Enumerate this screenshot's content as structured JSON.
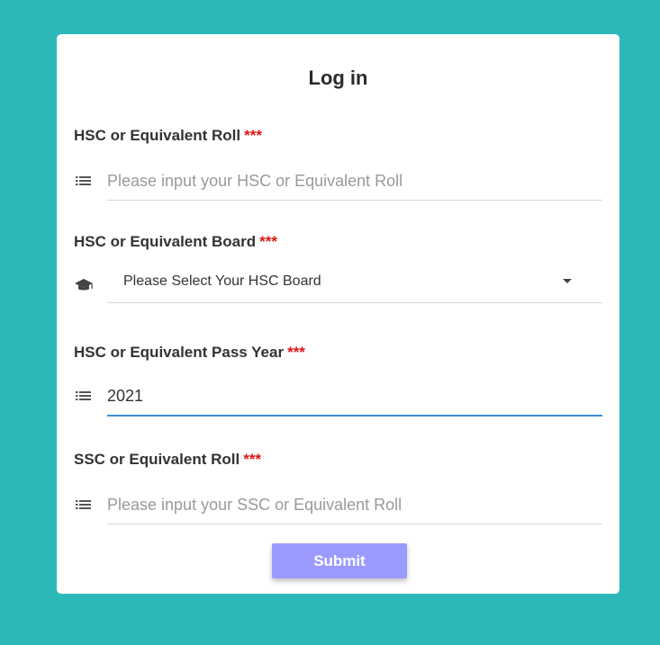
{
  "form": {
    "title": "Log in",
    "required_marker": "***",
    "fields": [
      {
        "label": "HSC or Equivalent Roll",
        "icon": "list-icon",
        "type": "text",
        "value": "",
        "placeholder": "Please input your HSC or Equivalent Roll"
      },
      {
        "label": "HSC or Equivalent Board",
        "icon": "graduation-cap-icon",
        "type": "select",
        "selected": "Please Select Your HSC Board"
      },
      {
        "label": "HSC or Equivalent Pass Year",
        "icon": "list-icon",
        "type": "text",
        "value": "2021",
        "placeholder": ""
      },
      {
        "label": "SSC or Equivalent Roll",
        "icon": "list-icon",
        "type": "text",
        "value": "",
        "placeholder": "Please input your SSC or Equivalent Roll"
      }
    ],
    "submit_label": "Submit"
  },
  "colors": {
    "background": "#2db8b8",
    "card": "#ffffff",
    "required": "#e01414",
    "focus_underline": "#3b8fdd",
    "submit_button": "#9b9bff"
  }
}
